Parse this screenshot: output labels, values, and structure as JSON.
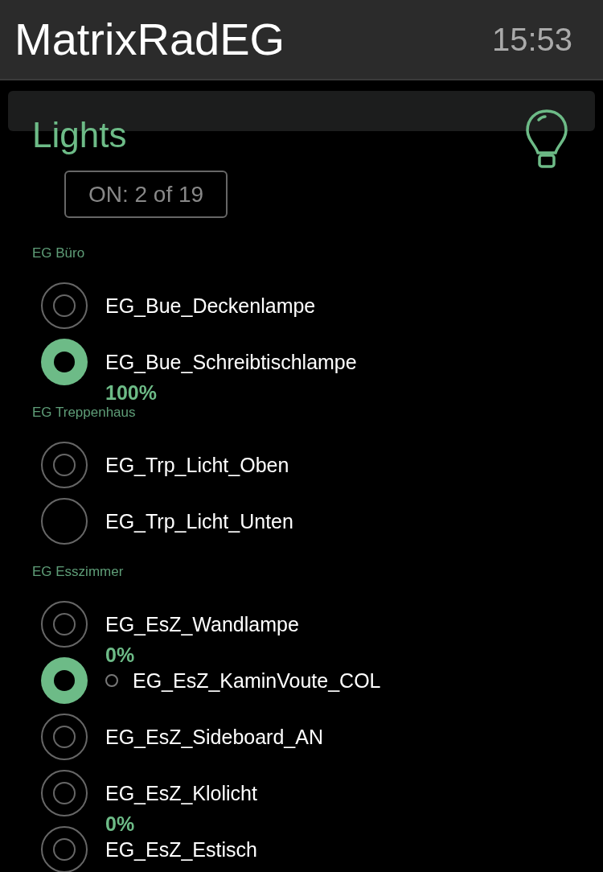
{
  "header": {
    "title": "MatrixRadEG",
    "time": "15:53"
  },
  "panel": {
    "title": "Lights",
    "summary": "ON: 2 of 19"
  },
  "sections": [
    {
      "label": "EG Büro",
      "items": [
        {
          "name": "EG_Bue_Deckenlampe",
          "on": false,
          "available": true,
          "kind": "switch"
        },
        {
          "name": "EG_Bue_Schreibtischlampe",
          "on": true,
          "available": true,
          "kind": "switch",
          "reading": "100%"
        }
      ]
    },
    {
      "label": "EG Treppenhaus",
      "items": [
        {
          "name": "EG_Trp_Licht_Oben",
          "on": false,
          "available": true,
          "kind": "switch"
        },
        {
          "name": "EG_Trp_Licht_Unten",
          "available": false,
          "kind": "switch"
        }
      ]
    },
    {
      "label": "EG Esszimmer",
      "items": [
        {
          "name": "EG_EsZ_Wandlampe",
          "on": false,
          "available": true,
          "kind": "switch",
          "reading": "0%"
        },
        {
          "name": "EG_EsZ_KaminVoute_COL",
          "on": true,
          "available": true,
          "kind": "color"
        },
        {
          "name": "EG_EsZ_Sideboard_AN",
          "on": false,
          "available": true,
          "kind": "switch"
        },
        {
          "name": "EG_EsZ_Klolicht",
          "on": false,
          "available": true,
          "kind": "switch",
          "reading": "0%"
        },
        {
          "name": "EG_EsZ_Estisch",
          "on": false,
          "available": true,
          "kind": "switch"
        }
      ]
    }
  ]
}
